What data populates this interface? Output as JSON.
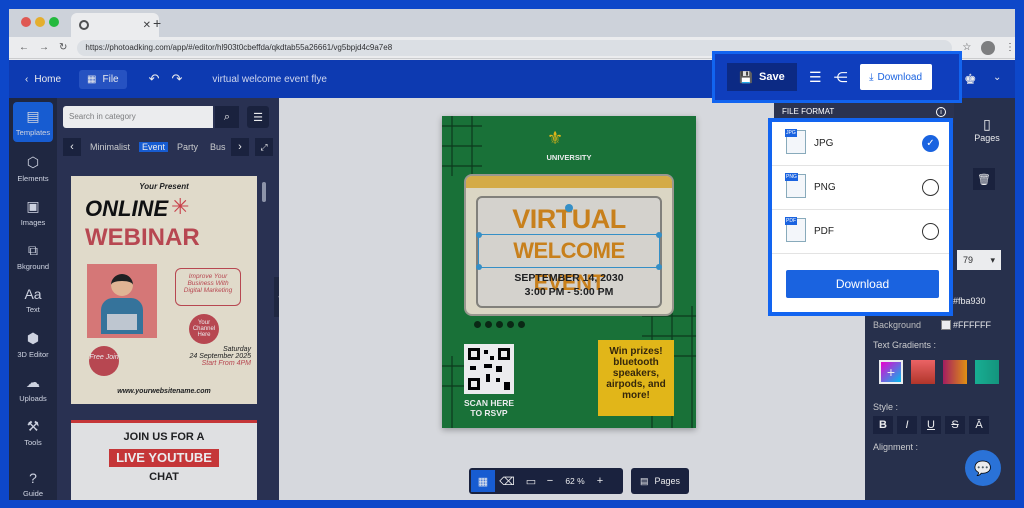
{
  "browser": {
    "url": "https://photoadking.com/app/#/editor/hl903t0cbeffda/qkdtab55a26661/vg5bpjd4c9a7e8"
  },
  "topbar": {
    "home_label": "Home",
    "file_label": "File",
    "doc_title": "virtual welcome event flye",
    "save_label": "Save",
    "download_label": "Download"
  },
  "rail": {
    "items": [
      {
        "label": "Templates",
        "icon": "templates-icon"
      },
      {
        "label": "Elements",
        "icon": "elements-icon"
      },
      {
        "label": "Images",
        "icon": "images-icon"
      },
      {
        "label": "Bkground",
        "icon": "background-icon"
      },
      {
        "label": "Text",
        "icon": "text-icon"
      },
      {
        "label": "3D Editor",
        "icon": "cube-icon"
      },
      {
        "label": "Uploads",
        "icon": "upload-icon"
      },
      {
        "label": "Tools",
        "icon": "tools-icon"
      },
      {
        "label": "Guide",
        "icon": "guide-icon"
      }
    ]
  },
  "panel": {
    "search_placeholder": "Search in category",
    "categories": [
      "Minimalist",
      "Event",
      "Party",
      "Bus"
    ],
    "active_category": "Event",
    "card1": {
      "pretitle": "Your Present",
      "title1": "ONLINE",
      "title2": "WEBINAR",
      "bubble": "Improve Your Business With Digital Marketing",
      "channel": "Your Channel Here",
      "free": "Free Join",
      "date_day": "Saturday",
      "date": "24 September 2025",
      "time": "Start From 4PM",
      "site": "www.yourwebsitename.com"
    },
    "card2": {
      "line1": "JOIN US FOR A",
      "line2": "LIVE YOUTUBE",
      "line3": "CHAT"
    }
  },
  "flyer": {
    "logo_text": "UNIVERSITY",
    "title1": "VIRTUAL",
    "title2": "WELCOME EVENT",
    "date": "SEPTEMBER 14, 2030",
    "time": "3:00 PM - 5:00 PM",
    "scan1": "SCAN HERE",
    "scan2": "TO RSVP",
    "prize": "Win prizes! bluetooth speakers, airpods, and more!",
    "colors": {
      "green": "#1c7a3a",
      "yellow": "#f5c518",
      "orange": "#d98a1c"
    }
  },
  "bottombar": {
    "zoom": "62 %",
    "pages_label": "Pages"
  },
  "rightpanel": {
    "pages_label": "Pages",
    "font_size": "79",
    "color1": "#fba930",
    "color2": "#FFFFFF",
    "bg_label": "Background",
    "gradients_label": "Text Gradients :",
    "style_label": "Style :",
    "alignment_label": "Alignment :"
  },
  "download_menu": {
    "header": "FILE FORMAT",
    "options": [
      {
        "label": "JPG",
        "badge": "JPG",
        "selected": true
      },
      {
        "label": "PNG",
        "badge": "PNG",
        "selected": false
      },
      {
        "label": "PDF",
        "badge": "PDF",
        "selected": false
      }
    ],
    "button": "Download"
  }
}
